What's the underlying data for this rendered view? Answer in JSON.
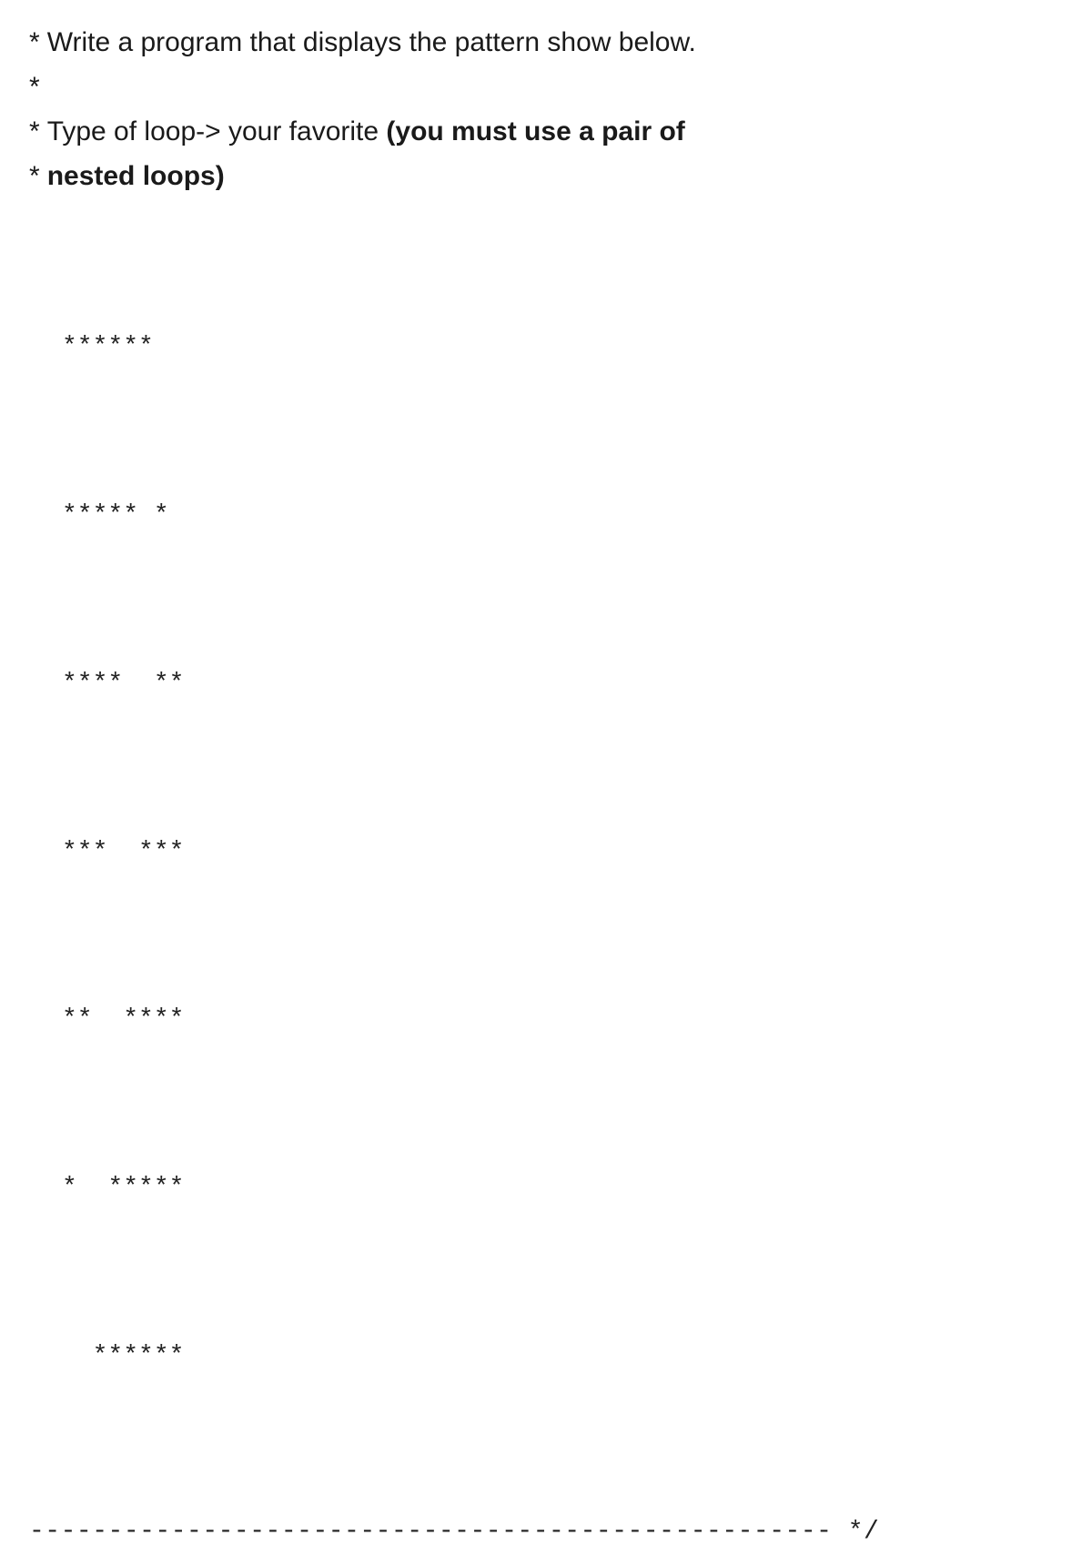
{
  "lines": {
    "l1_prefix": "*",
    "l1_text": "Write a program that displays the pattern show below.",
    "l2_prefix": "*",
    "l3_prefix": "*",
    "l3_text": "Type of loop-> your favorite ",
    "l3_bold": "(you must use a pair of",
    "l4_prefix": "*",
    "l4_bold": "nested loops)"
  },
  "pattern": [
    "******",
    "***** *",
    "****  **",
    "***  ***",
    "**  ****",
    "*  *****",
    "  ******"
  ],
  "footer": "--------------------------------------------------- */"
}
